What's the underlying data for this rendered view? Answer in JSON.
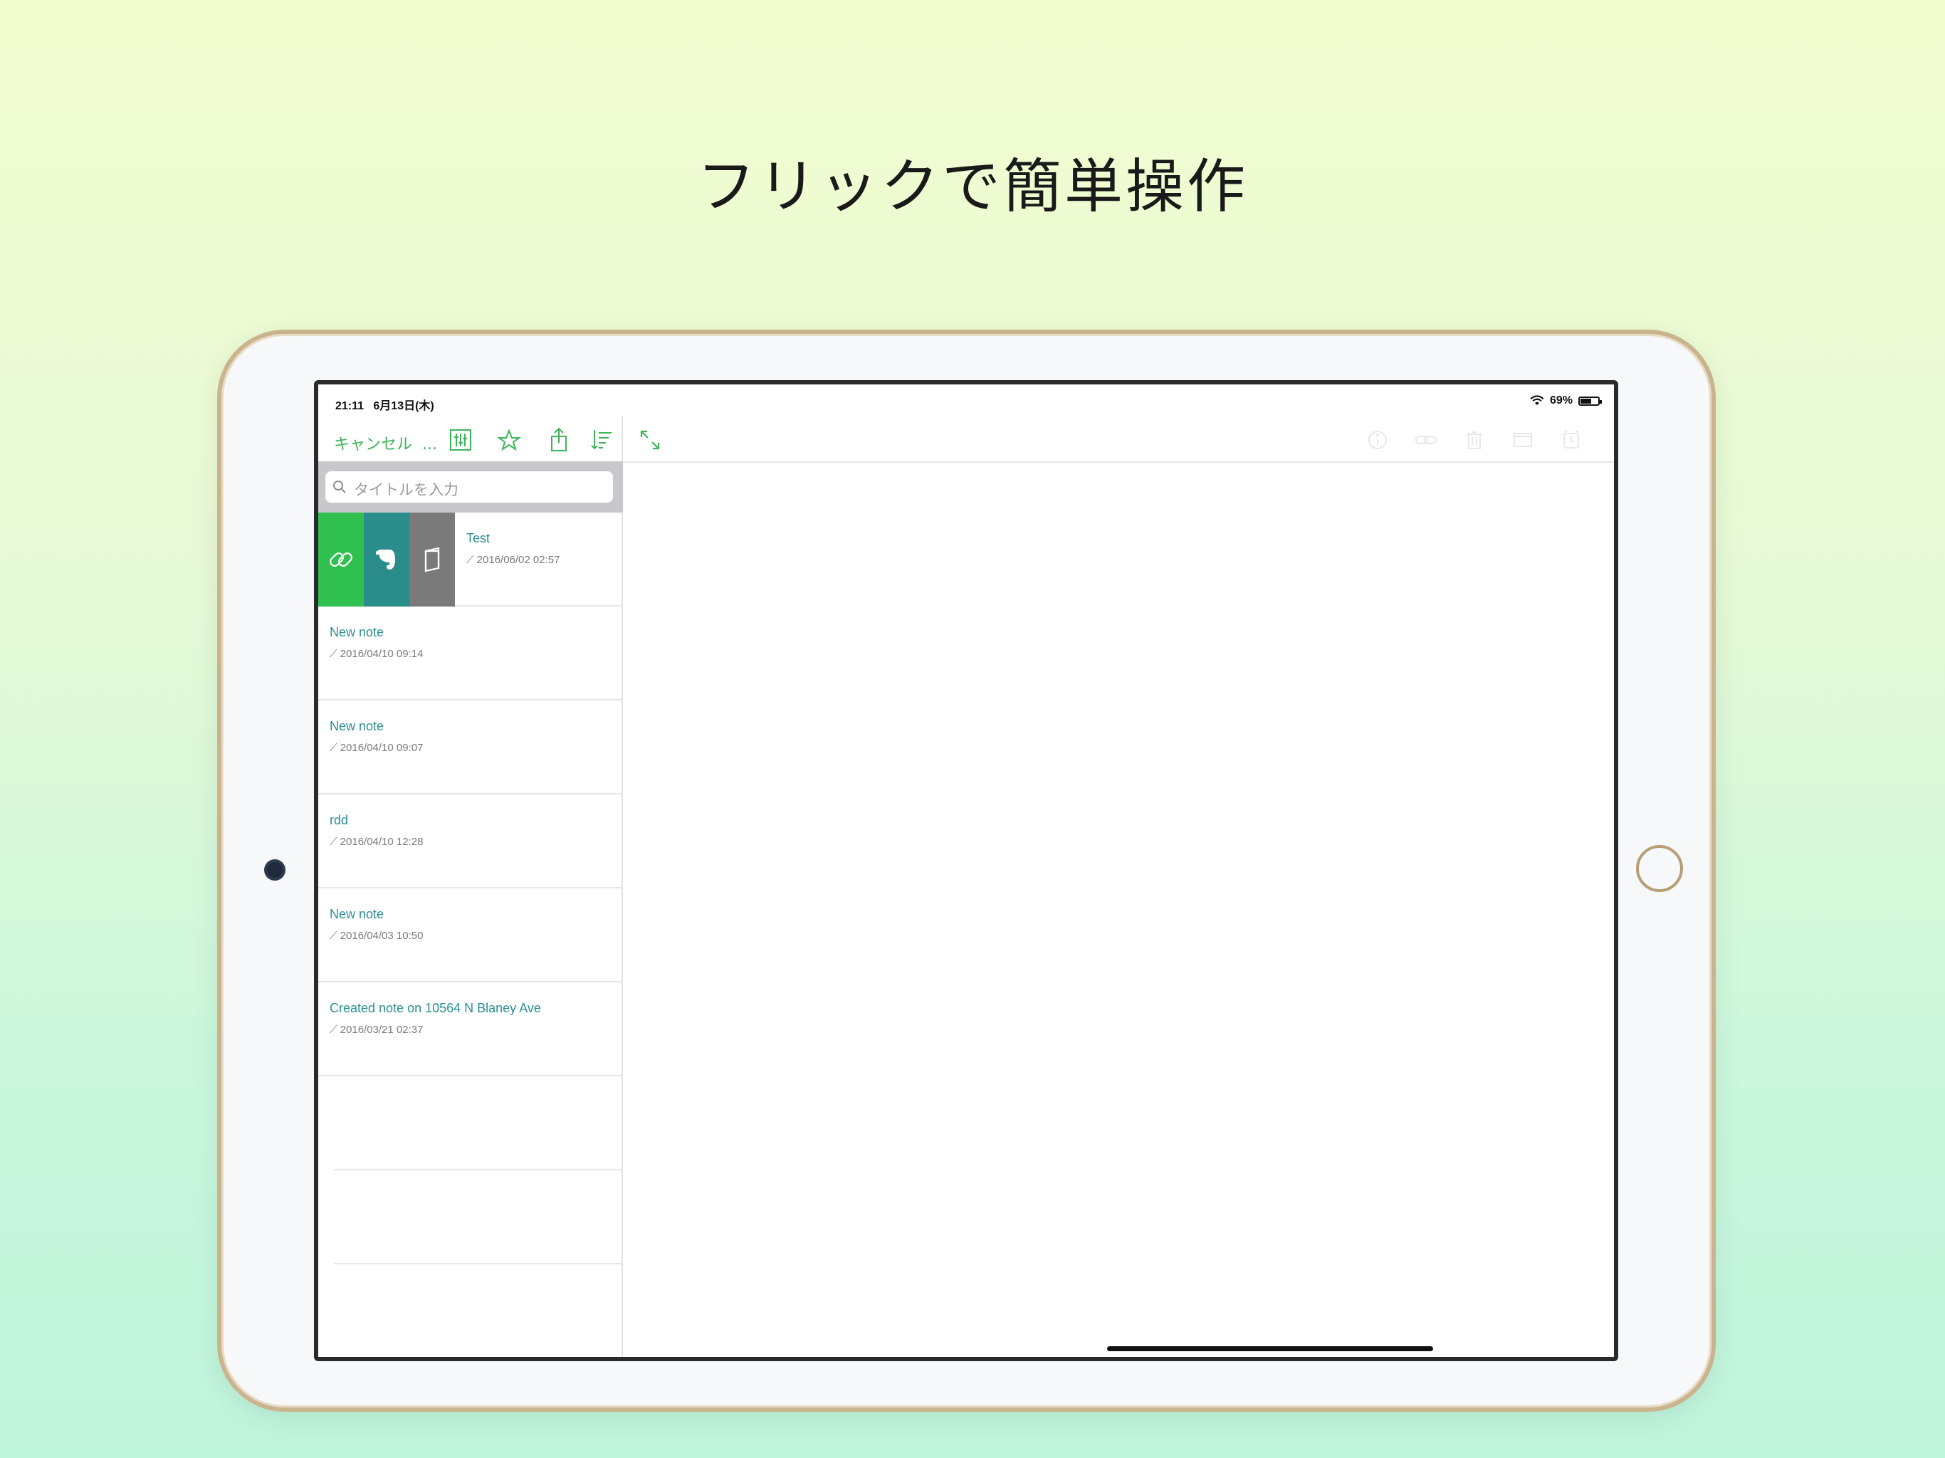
{
  "headline": "フリックで簡単操作",
  "status": {
    "time": "21:11",
    "date": "6月13日(木)",
    "battery": "69%",
    "battery_level": 0.69
  },
  "left_toolbar": {
    "cancel": "キャンセル",
    "more": "..."
  },
  "search": {
    "placeholder": "タイトルを入力"
  },
  "notes": [
    {
      "title": "Test",
      "date": "2016/06/02 02:57"
    },
    {
      "title": "New note",
      "date": "2016/04/10 09:14"
    },
    {
      "title": "New note",
      "date": "2016/04/10 09:07"
    },
    {
      "title": "rdd",
      "date": "2016/04/10 12:28"
    },
    {
      "title": "New note",
      "date": "2016/04/03 10:50"
    },
    {
      "title": "Created note on 10564 N Blaney Ave",
      "date": "2016/03/21 02:37"
    }
  ],
  "swipe_actions": [
    "link-icon",
    "evernote-icon",
    "notebook-icon"
  ],
  "icons": {
    "toolbar_left": [
      "sliders-icon",
      "star-icon",
      "share-icon",
      "sort-icon"
    ],
    "toolbar_right": [
      "info-icon",
      "link-icon",
      "trash-icon",
      "window-icon",
      "alarm-icon"
    ],
    "expand": "expand-icon"
  },
  "colors": {
    "accent": "#3cb55a",
    "title": "#2a8f93",
    "swipe_green": "#2fc04f",
    "swipe_teal": "#2b8c8c",
    "swipe_gray": "#7a7a7a"
  }
}
